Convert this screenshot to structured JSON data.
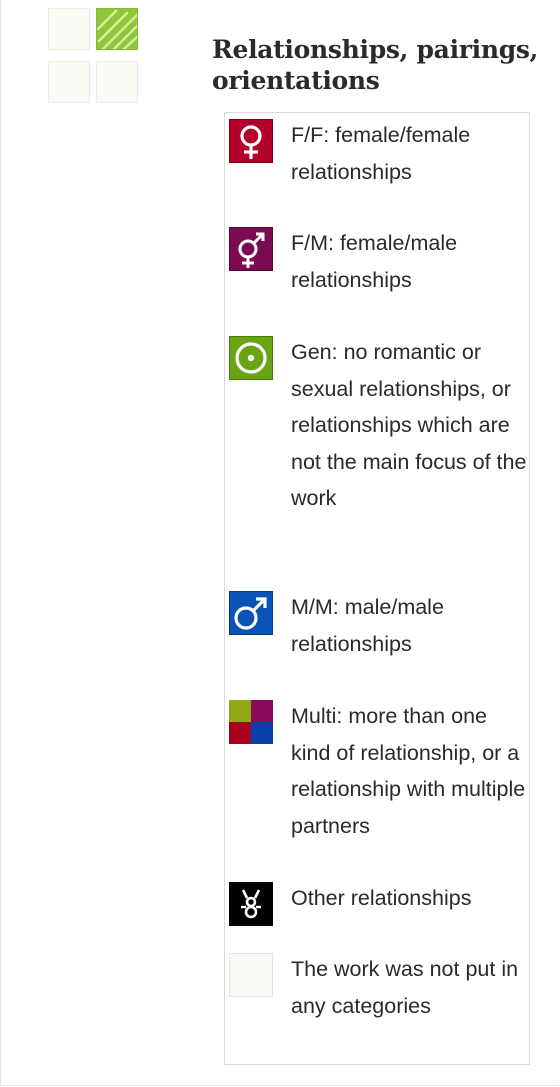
{
  "category_grid": {
    "cells": [
      "empty",
      "romance-category",
      "empty",
      "empty"
    ],
    "accent_color": "#8fc63a"
  },
  "title": "Relationships, pairings, orientations",
  "legend": {
    "items": [
      {
        "icon": "female-symbol-icon",
        "color": "#b3002b",
        "text": "F/F: female/female relationships"
      },
      {
        "icon": "female-male-symbol-icon",
        "color": "#7a0a52",
        "text": "F/M: female/male relationships"
      },
      {
        "icon": "gen-circle-icon",
        "color": "#6aa414",
        "text": "Gen: no romantic or sexual relationships, or relationships which are not the main focus of the work"
      },
      {
        "icon": "male-symbol-icon",
        "color": "#0a52b3",
        "text": "M/M: male/male relationships"
      },
      {
        "icon": "multi-squares-icon",
        "color": "#8fa814",
        "text": "Multi: more than one kind of relationship, or a relationship with multiple partners"
      },
      {
        "icon": "other-symbol-icon",
        "color": "#000000",
        "text": "Other relationships"
      },
      {
        "icon": "no-category-icon",
        "color": "#fbfaf5",
        "text": "The work was not put in any categories"
      }
    ]
  }
}
